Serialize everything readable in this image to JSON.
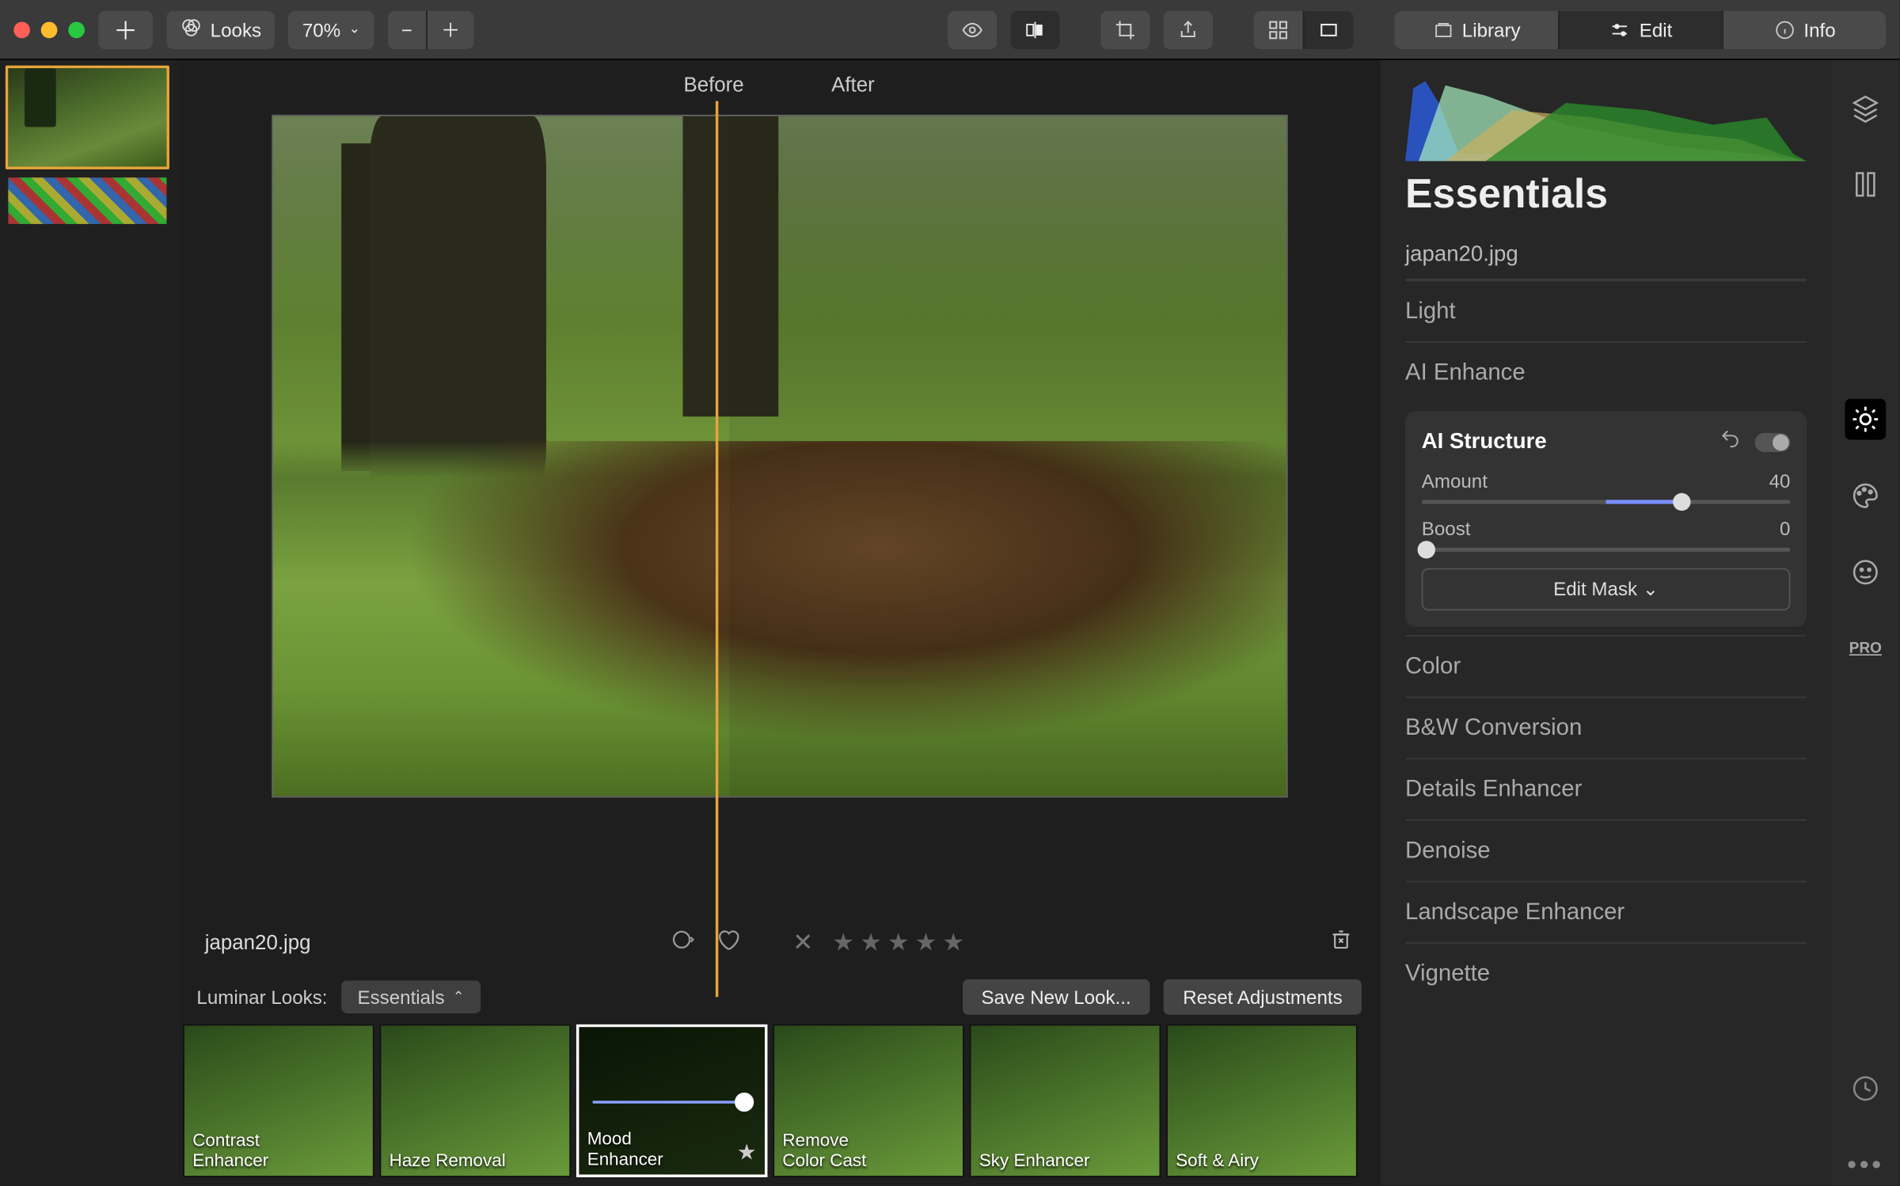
{
  "titlebar": {
    "looks_label": "Looks",
    "zoom_label": "70%",
    "library_label": "Library",
    "edit_label": "Edit",
    "info_label": "Info"
  },
  "compare": {
    "before": "Before",
    "after": "After"
  },
  "meta": {
    "filename": "japan20.jpg"
  },
  "looksbar": {
    "prefix": "Luminar Looks:",
    "category": "Essentials",
    "save_new": "Save New Look...",
    "reset": "Reset Adjustments"
  },
  "looks": [
    {
      "label": "Contrast\nEnhancer"
    },
    {
      "label": "Haze Removal"
    },
    {
      "label": "Mood\nEnhancer",
      "selected": true,
      "star": true
    },
    {
      "label": "Remove\nColor Cast"
    },
    {
      "label": "Sky Enhancer"
    },
    {
      "label": "Soft & Airy"
    }
  ],
  "panel": {
    "title": "Essentials",
    "filename": "japan20.jpg",
    "sections": [
      "Light",
      "AI Enhance"
    ],
    "ai_structure": {
      "title": "AI Structure",
      "amount_label": "Amount",
      "amount_value": "40",
      "boost_label": "Boost",
      "boost_value": "0",
      "edit_mask": "Edit Mask ⌄"
    },
    "sections2": [
      "Color",
      "B&W Conversion",
      "Details Enhancer",
      "Denoise",
      "Landscape Enhancer",
      "Vignette"
    ]
  },
  "toolrail": {
    "pro": "PRO"
  },
  "colors": {
    "close": "#ff5f57",
    "min": "#febc2e",
    "max": "#28c840",
    "accent": "#e6a53a"
  }
}
